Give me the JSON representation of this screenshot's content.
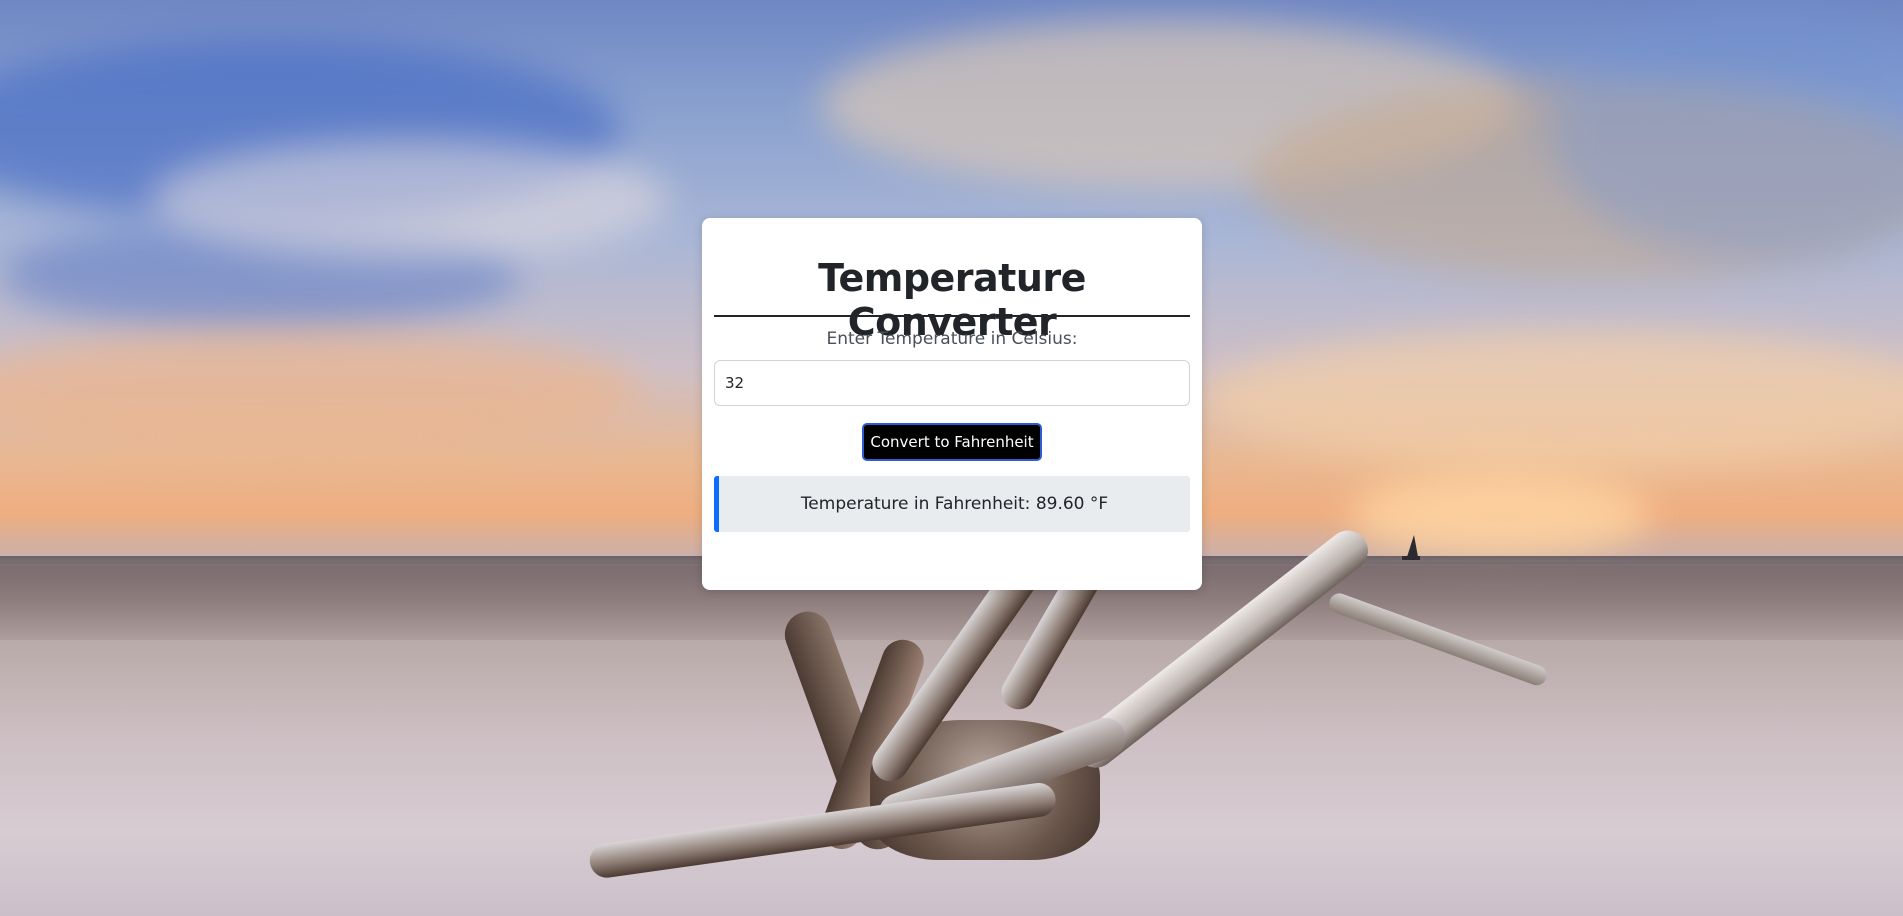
{
  "converter": {
    "title": "Temperature Converter",
    "input_label": "Enter Temperature in Celsius:",
    "input_value": "32",
    "convert_button_label": "Convert to Fahrenheit",
    "result_text": "Temperature in Fahrenheit: 89.60 °F"
  },
  "colors": {
    "button_background": "#000000",
    "button_border": "#2f5bd3",
    "result_accent": "#0d6efd",
    "result_background": "#e9ecef",
    "title_color": "#212529"
  }
}
